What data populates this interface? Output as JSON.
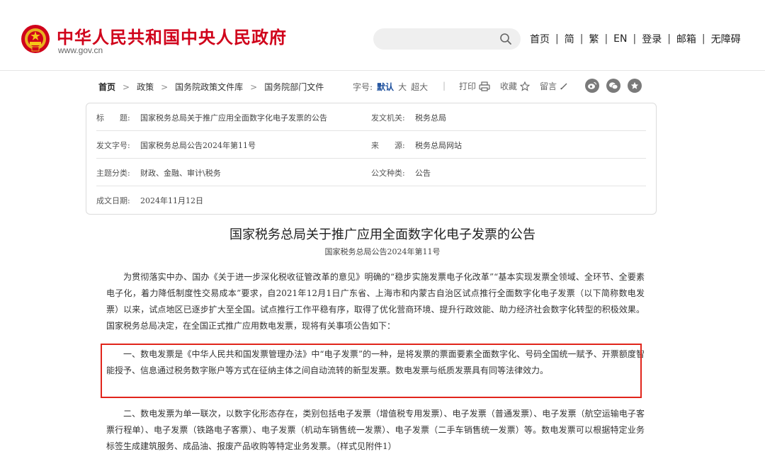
{
  "header": {
    "site_title": "中华人民共和国中央人民政府",
    "site_url": "www.gov.cn",
    "search_placeholder": "",
    "nav": [
      "首页",
      "简",
      "繁",
      "EN",
      "登录",
      "邮箱",
      "无障碍"
    ],
    "brand_color": "#d0021b"
  },
  "breadcrumb": {
    "items": [
      "首页",
      "政策",
      "国务院政策文件库",
      "国务院部门文件"
    ]
  },
  "font_size": {
    "label": "字号:",
    "options": [
      "默认",
      "大",
      "超大"
    ],
    "selected": "默认"
  },
  "tools": {
    "print": "打印",
    "favorite": "收藏",
    "comment": "留言"
  },
  "share_icons": [
    "weibo-icon",
    "wechat-icon",
    "star-icon"
  ],
  "info": {
    "title_label": "标　　题:",
    "title_value": "国家税务总局关于推广应用全面数字化电子发票的公告",
    "issuer_label": "发文机关:",
    "issuer_value": "税务总局",
    "docno_label": "发文字号:",
    "docno_value": "国家税务总局公告2024年第11号",
    "source_label": "来　　源:",
    "source_value": "税务总局网站",
    "topic_label": "主题分类:",
    "topic_value": "财政、金融、审计\\税务",
    "type_label": "公文种类:",
    "type_value": "公告",
    "date_label": "成文日期:",
    "date_value": "2024年11月12日"
  },
  "article": {
    "title": "国家税务总局关于推广应用全面数字化电子发票的公告",
    "doc_number": "国家税务总局公告2024年第11号",
    "paragraphs": [
      "为贯彻落实中办、国办《关于进一步深化税收征管改革的意见》明确的“稳步实施发票电子化改革”“基本实现发票全领域、全环节、全要素电子化，着力降低制度性交易成本”要求，自2021年12月1日广东省、上海市和内蒙古自治区试点推行全面数字化电子发票（以下简称数电发票）以来，试点地区已逐步扩大至全国。试点推行工作平稳有序，取得了优化营商环境、提升行政效能、助力经济社会数字化转型的积极效果。国家税务总局决定，在全国正式推广应用数电发票，现将有关事项公告如下：",
      "一、数电发票是《中华人民共和国发票管理办法》中“电子发票”的一种，是将发票的票面要素全面数字化、号码全国统一赋予、开票额度智能授予、信息通过税务数字账户等方式在征纳主体之间自动流转的新型发票。数电发票与纸质发票具有同等法律效力。",
      "二、数电发票为单一联次，以数字化形态存在，类别包括电子发票（增值税专用发票）、电子发票（普通发票）、电子发票（航空运输电子客票行程单）、电子发票（铁路电子客票）、电子发票（机动车销售统一发票）、电子发票（二手车销售统一发票）等。数电发票可以根据特定业务标签生成建筑服务、成品油、报废产品收购等特定业务发票。（样式见附件1）"
    ],
    "highlight_color": "#e1251b"
  }
}
